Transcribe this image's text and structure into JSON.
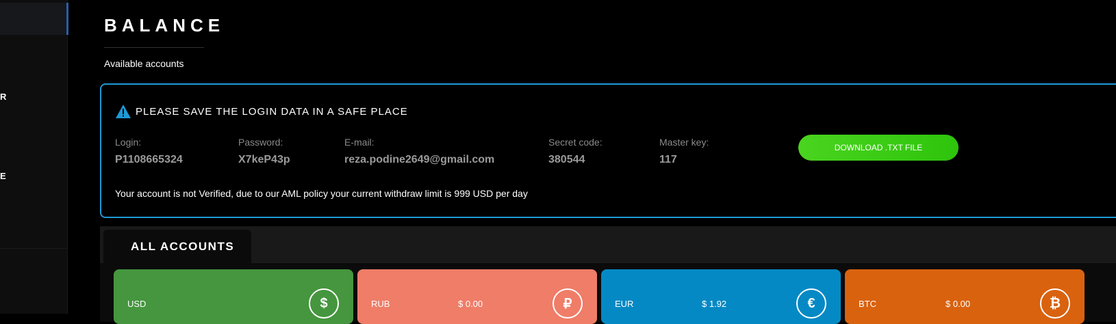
{
  "sidebar": {
    "items": [
      {
        "label": "R"
      },
      {
        "label": "E"
      }
    ]
  },
  "page": {
    "title": "BALANCE",
    "subtitle": "Available accounts"
  },
  "notice": {
    "title": "PLEASE SAVE THE LOGIN DATA IN A SAFE PLACE",
    "icon": "warning-icon",
    "fields": [
      {
        "label": "Login:",
        "value": "P1108665324"
      },
      {
        "label": "Password:",
        "value": "X7keP43p"
      },
      {
        "label": "E-mail:",
        "value": "reza.podine2649@gmail.com"
      },
      {
        "label": "Secret code:",
        "value": "380544"
      },
      {
        "label": "Master key:",
        "value": "117"
      }
    ],
    "download_label": "DOWNLOAD .TXT FILE",
    "message": "Your account is not Verified, due to our AML policy your current withdraw limit is 999 USD per day"
  },
  "accounts": {
    "tab_label": "ALL ACCOUNTS",
    "cards": [
      {
        "currency": "USD",
        "amount": "",
        "symbol": "$",
        "icon": "dollar-icon",
        "color": "#45963e"
      },
      {
        "currency": "RUB",
        "amount": "$ 0.00",
        "symbol": "₽",
        "icon": "ruble-icon",
        "color": "#ef7d68"
      },
      {
        "currency": "EUR",
        "amount": "$ 1.92",
        "symbol": "€",
        "icon": "euro-icon",
        "color": "#0589c4"
      },
      {
        "currency": "BTC",
        "amount": "$ 0.00",
        "symbol": "₿",
        "icon": "bitcoin-icon",
        "color": "#d9620f"
      }
    ]
  },
  "colors": {
    "accent_border": "#1d9ad6",
    "download_green": "#2ec40c"
  }
}
